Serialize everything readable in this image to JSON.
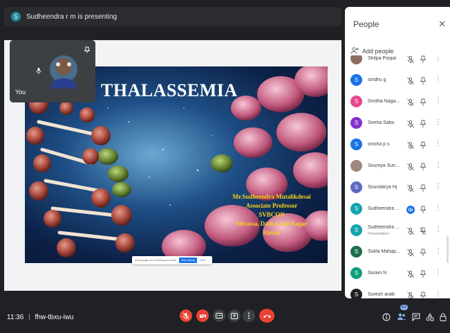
{
  "presenter_bar": {
    "avatar_letter": "S",
    "text": "Sudheendra r m is presenting"
  },
  "self_tile": {
    "label": "You"
  },
  "slide": {
    "title": "THALASSEMIA",
    "author_lines": [
      "Mr.Sudheendra Mutalikdesai",
      "Associate Professor",
      "SVBCON",
      "Silvassa, Dadra and Nagar",
      "Haveli"
    ]
  },
  "share_notice": {
    "text": "meet.google.com is sharing your screen.",
    "stop_label": "Stop sharing",
    "hide_label": "Hide"
  },
  "people_panel": {
    "title": "People",
    "add_label": "Add people",
    "participants": [
      {
        "name": "Shilpa Poojar",
        "avatar": "",
        "color": "#8d6e63",
        "photo": true,
        "presenting": false,
        "sub": ""
      },
      {
        "name": "sindhu g",
        "avatar": "S",
        "color": "#1a73e8",
        "photo": false,
        "presenting": false,
        "sub": ""
      },
      {
        "name": "Smitha Naga...",
        "avatar": "S",
        "color": "#e8488c",
        "photo": false,
        "presenting": false,
        "sub": ""
      },
      {
        "name": "Sneha Sabu",
        "avatar": "S",
        "color": "#8430ce",
        "photo": false,
        "presenting": false,
        "sub": ""
      },
      {
        "name": "snisha p s",
        "avatar": "S",
        "color": "#1a73e8",
        "photo": false,
        "presenting": false,
        "sub": ""
      },
      {
        "name": "Soumya Sun...",
        "avatar": "",
        "color": "#a1887f",
        "photo": true,
        "presenting": false,
        "sub": ""
      },
      {
        "name": "Soundarya Hj",
        "avatar": "S",
        "color": "#5c6bc0",
        "photo": false,
        "presenting": false,
        "sub": ""
      },
      {
        "name": "Sudheendra ...",
        "avatar": "S",
        "color": "#12a4af",
        "photo": false,
        "presenting": false,
        "sub": ""
      },
      {
        "name": "Sudheendra ...",
        "avatar": "S",
        "color": "#12a4af",
        "photo": false,
        "presenting": true,
        "sub": "Presentation"
      },
      {
        "name": "Sukla Mahap...",
        "avatar": "S",
        "color": "#1e6e4e",
        "photo": false,
        "presenting": false,
        "sub": ""
      },
      {
        "name": "Surain N",
        "avatar": "S",
        "color": "#129e7a",
        "photo": false,
        "presenting": false,
        "sub": ""
      },
      {
        "name": "Suresh aralli",
        "avatar": "S",
        "color": "#202124",
        "photo": false,
        "presenting": false,
        "sub": ""
      }
    ]
  },
  "bottom_bar": {
    "time": "11:36",
    "separator": "|",
    "meeting_code": "fhw-tbxu-iwu",
    "participant_count": "61"
  },
  "colors": {
    "end_call": "#ea4335",
    "background": "#202124",
    "accent": "#1a73e8"
  }
}
